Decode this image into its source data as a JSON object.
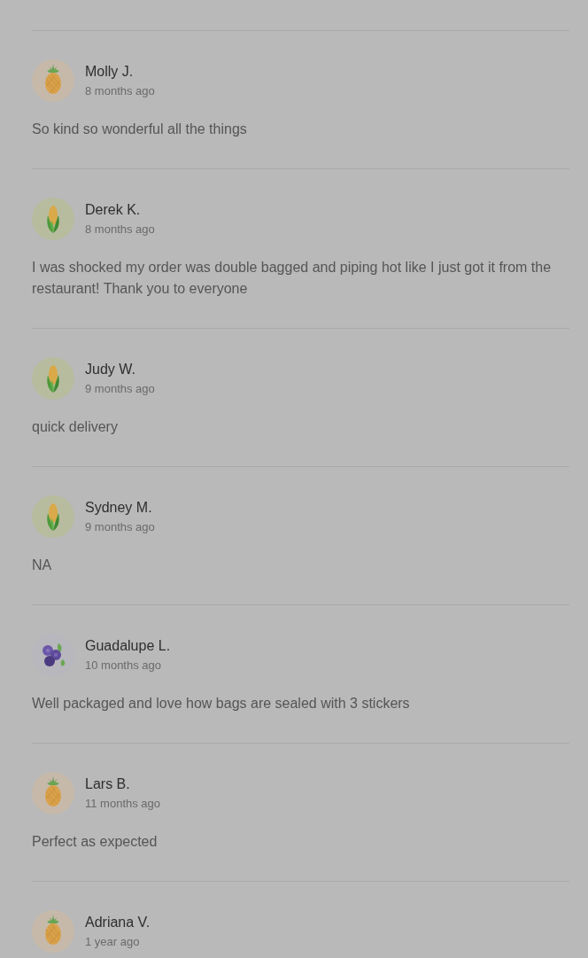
{
  "reviews": [
    {
      "kind": "pineapple",
      "name": "Molly J.",
      "time": "8 months ago",
      "text": "So kind so wonderful all the things"
    },
    {
      "kind": "corn",
      "name": "Derek K.",
      "time": "8 months ago",
      "text": "I was shocked my order was double bagged and piping hot like I just got it from the restaurant! Thank you to everyone"
    },
    {
      "kind": "corn",
      "name": "Judy W.",
      "time": "9 months ago",
      "text": "quick delivery"
    },
    {
      "kind": "corn",
      "name": "Sydney M.",
      "time": "9 months ago",
      "text": "NA"
    },
    {
      "kind": "berries",
      "name": "Guadalupe L.",
      "time": "10 months ago",
      "text": "Well packaged and love how bags are sealed with 3 stickers"
    },
    {
      "kind": "pineapple",
      "name": "Lars B.",
      "time": "11 months ago",
      "text": "Perfect as expected"
    },
    {
      "kind": "pineapple",
      "name": "Adriana V.",
      "time": "1 year ago"
    }
  ]
}
